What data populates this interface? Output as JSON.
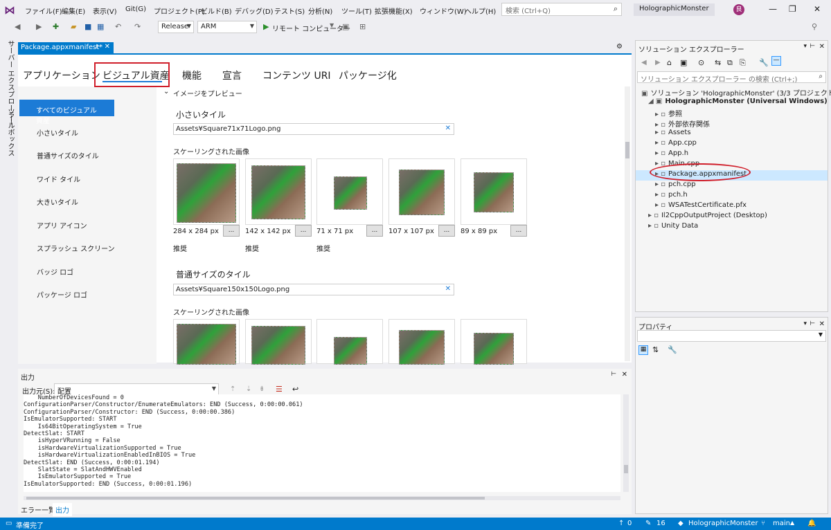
{
  "menubar": {
    "items": [
      "ファイル(F)",
      "編集(E)",
      "表示(V)",
      "Git(G)",
      "プロジェクト(P)",
      "ビルド(B)",
      "デバッグ(D)",
      "テスト(S)",
      "分析(N)",
      "ツール(T)",
      "拡張機能(X)",
      "ウィンドウ(W)",
      "ヘルプ(H)"
    ],
    "search_placeholder": "検索 (Ctrl+Q)",
    "solution_name": "HolographicMonster",
    "avatar_initial": "良"
  },
  "toolbar": {
    "config": "Release",
    "platform": "ARM",
    "run_target": "リモート コンピューター"
  },
  "side_strip": {
    "server_explorer": "サーバー エクスプローラー",
    "toolbox": "ツールボックス"
  },
  "document_tab": {
    "label": "Package.appxmanifest*",
    "pin": "⊢"
  },
  "manifest": {
    "tabs": [
      "アプリケーション",
      "ビジュアル資産",
      "機能",
      "宣言",
      "コンテンツ URI",
      "パッケージ化"
    ],
    "selected_tab": "ビジュアル資産",
    "nav": [
      "すべてのビジュアル資産",
      "小さいタイル",
      "普通サイズのタイル",
      "ワイド タイル",
      "大きいタイル",
      "アプリ アイコン",
      "スプラッシュ スクリーン",
      "バッジ ロゴ",
      "パッケージ ロゴ"
    ],
    "preview_header": "イメージをプレビュー",
    "small_tile": {
      "title": "小さいタイル",
      "path": "Assets¥Square71x71Logo.png",
      "scaled_label": "スケーリングされた画像",
      "sizes": [
        "284 x 284 px",
        "142 x 142 px",
        "71 x 71 px",
        "107 x 107 px",
        "89 x 89 px"
      ],
      "recommended": [
        "推奨",
        "推奨",
        "推奨",
        "",
        ""
      ]
    },
    "medium_tile": {
      "title": "普通サイズのタイル",
      "path": "Assets¥Square150x150Logo.png",
      "scaled_label": "スケーリングされた画像"
    },
    "browse_label": "..."
  },
  "output": {
    "title": "出力",
    "source_label": "出力元(S):",
    "source_value": "配置",
    "lines": [
      "    NumberOfDevicesFound = 0",
      "ConfigurationParser/Constructor/EnumerateEmulators: END (Success, 0:00:00.061)",
      "ConfigurationParser/Constructor: END (Success, 0:00:00.386)",
      "IsEmulatorSupported: START",
      "    Is64BitOperatingSystem = True",
      "DetectSlat: START",
      "    isHyperVRunning = False",
      "    isHardwareVirtualizationSupported = True",
      "    isHardwareVirtualizationEnabledInBIOS = True",
      "DetectSlat: END (Success, 0:00:01.194)",
      "    SlatState = SlatAndHWVEnabled",
      "    IsEmulatorSupported = True",
      "IsEmulatorSupported: END (Success, 0:00:01.196)"
    ],
    "bottom_tabs": [
      "エラー一覧",
      "出力"
    ]
  },
  "solution_explorer": {
    "title": "ソリューション エクスプローラー",
    "search_placeholder": "ソリューション エクスプローラー の検索 (Ctrl+;)",
    "items": [
      {
        "label": "ソリューション 'HolographicMonster' (3/3 プロジェクト)",
        "indent": 0
      },
      {
        "label": "HolographicMonster (Universal Windows)",
        "indent": 1,
        "bold": true
      },
      {
        "label": "参照",
        "indent": 2
      },
      {
        "label": "外部依存関係",
        "indent": 2
      },
      {
        "label": "Assets",
        "indent": 2
      },
      {
        "label": "App.cpp",
        "indent": 2
      },
      {
        "label": "App.h",
        "indent": 2
      },
      {
        "label": "Main.cpp",
        "indent": 2
      },
      {
        "label": "Package.appxmanifest",
        "indent": 2,
        "selected": true
      },
      {
        "label": "pch.cpp",
        "indent": 2
      },
      {
        "label": "pch.h",
        "indent": 2
      },
      {
        "label": "WSATestCertificate.pfx",
        "indent": 2
      },
      {
        "label": "Il2CppOutputProject (Desktop)",
        "indent": 1
      },
      {
        "label": "Unity Data",
        "indent": 1
      }
    ]
  },
  "properties": {
    "title": "プロパティ"
  },
  "statusbar": {
    "ready": "準備完了",
    "errors": "0",
    "edits": "16",
    "repo": "HolographicMonster",
    "branch": "main"
  },
  "colors": {
    "accent": "#007acc",
    "highlight_red": "#d01e2a"
  }
}
